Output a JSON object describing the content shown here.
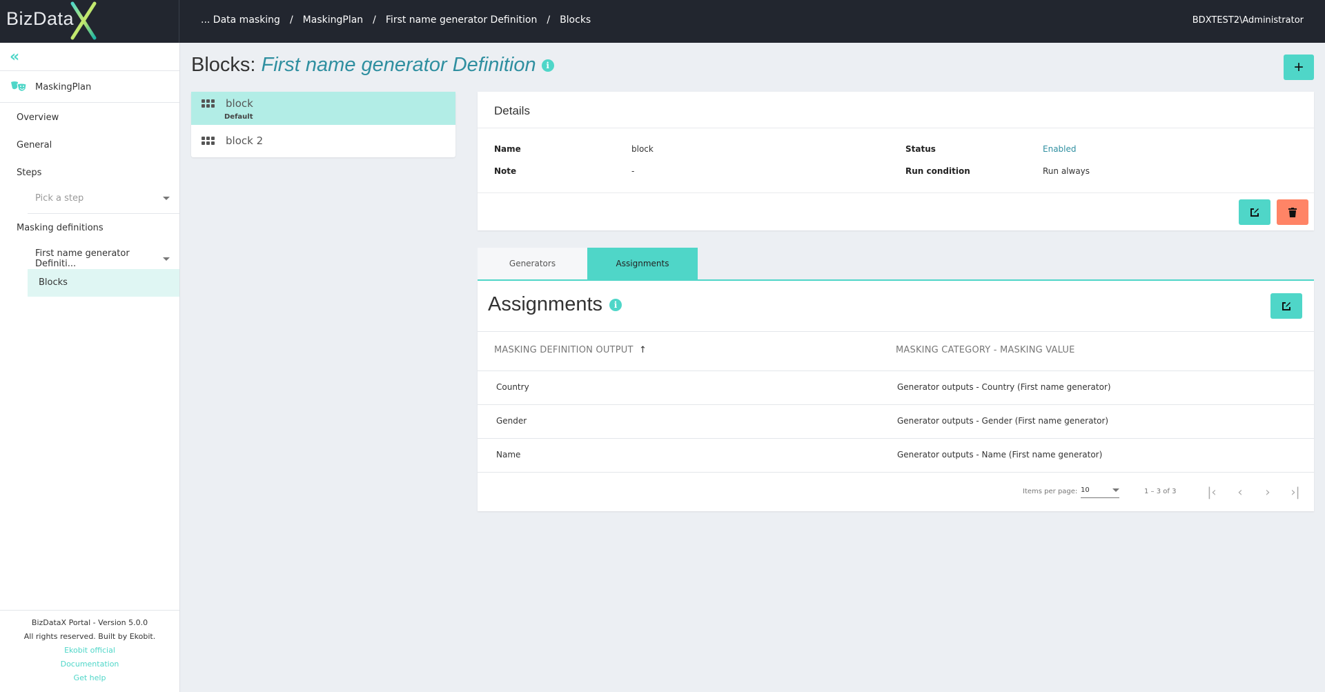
{
  "header": {
    "logo_text": "BizData",
    "breadcrumb": [
      "... Data masking",
      "MaskingPlan",
      "First name generator Definition",
      "Blocks"
    ],
    "breadcrumb_separator": "/",
    "user": "BDXTEST2\\Administrator"
  },
  "sidebar": {
    "collapse_icon": "«",
    "plan_name": "MaskingPlan",
    "items": {
      "overview": "Overview",
      "general": "General",
      "steps": "Steps",
      "steps_placeholder": "Pick a step",
      "masking_definitions": "Masking definitions",
      "masking_definition_selected": "First name generator Definiti...",
      "blocks": "Blocks"
    },
    "footer": {
      "version": "BizDataX Portal - Version 5.0.0",
      "rights": "All rights reserved. Built by Ekobit.",
      "links": [
        "Ekobit official",
        "Documentation",
        "Get help"
      ]
    }
  },
  "page": {
    "title_prefix": "Blocks:",
    "title_name": "First name generator Definition",
    "info_icon": "i",
    "add_label": "+"
  },
  "blocks": [
    {
      "name": "block",
      "sub": "Default",
      "active": true
    },
    {
      "name": "block 2",
      "sub": "",
      "active": false
    }
  ],
  "details": {
    "title": "Details",
    "name_label": "Name",
    "name_value": "block",
    "note_label": "Note",
    "note_value": "-",
    "status_label": "Status",
    "status_value": "Enabled",
    "run_label": "Run condition",
    "run_value": "Run always"
  },
  "tabs": [
    {
      "label": "Generators",
      "active": false
    },
    {
      "label": "Assignments",
      "active": true
    }
  ],
  "assignments": {
    "title": "Assignments",
    "columns": [
      "MASKING DEFINITION OUTPUT",
      "MASKING CATEGORY - MASKING VALUE"
    ],
    "sort_indicator": "↑",
    "rows": [
      [
        "Country",
        "Generator outputs - Country (First name generator)"
      ],
      [
        "Gender",
        "Generator outputs - Gender (First name generator)"
      ],
      [
        "Name",
        "Generator outputs - Name (First name generator)"
      ]
    ],
    "paginator": {
      "items_per_page_label": "Items per page:",
      "items_per_page": "10",
      "range": "1 – 3 of 3"
    }
  },
  "colors": {
    "accent": "#4fd6c8",
    "danger": "#ff8466",
    "header_bg": "#22262f",
    "link": "#2f8fa0"
  }
}
